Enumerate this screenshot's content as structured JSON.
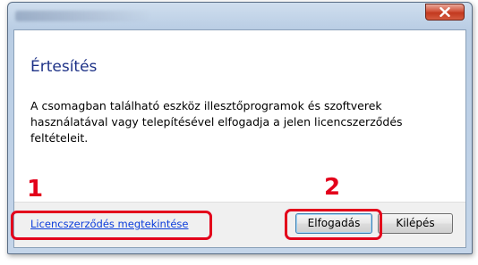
{
  "dialog": {
    "heading": "Értesítés",
    "message": "A csomagban található eszköz illesztőprogramok és szoftverek használatával vagy telepítésével elfogadja a jelen licencszerződés feltételeit.",
    "link_label": "Licencszerződés megtekintése",
    "accept_label": "Elfogadás",
    "exit_label": "Kilépés"
  },
  "annotations": {
    "marker_1": "1",
    "marker_2": "2",
    "color": "#e3001b"
  },
  "icons": {
    "close": "close-icon"
  }
}
